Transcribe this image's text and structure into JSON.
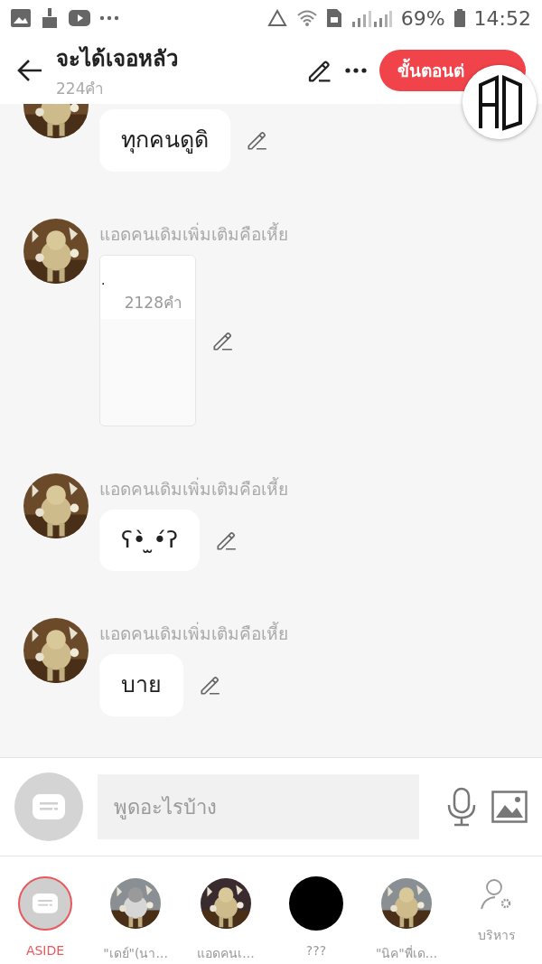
{
  "status_bar": {
    "battery": "69%",
    "time": "14:52"
  },
  "header": {
    "title": "จะได้เจอหลัว",
    "subtitle": "224คำ",
    "next_button": "ขั้นตอนต่"
  },
  "messages": [
    {
      "kind": "text",
      "text": "ทุกคนดูดิ"
    },
    {
      "kind": "doc",
      "sender": "แอดคนเดิมเพิ่มเติมคือเหี้ย",
      "doc_title": ".",
      "doc_count": "2128คำ"
    },
    {
      "kind": "text",
      "sender": "แอดคนเดิมเพิ่มเติมคือเหี้ย",
      "text": "ʕ•̀ ̫•́ʔ"
    },
    {
      "kind": "text",
      "sender": "แอดคนเดิมเพิ่มเติมคือเหี้ย",
      "text": "บาย"
    }
  ],
  "composer": {
    "placeholder": "พูดอะไรบ้าง"
  },
  "characters": [
    {
      "kind": "aside",
      "label": "ASIDE",
      "selected": true
    },
    {
      "kind": "picture",
      "label": "\"เดย์\"(นา...",
      "selected": false
    },
    {
      "kind": "picture",
      "label": "แอดคนเ...",
      "selected": false
    },
    {
      "kind": "blank",
      "label": "???",
      "selected": false
    },
    {
      "kind": "picture",
      "label": "\"นิค\"พี่เด...",
      "selected": false
    },
    {
      "kind": "manage",
      "label": "บริหาร",
      "selected": false
    }
  ]
}
